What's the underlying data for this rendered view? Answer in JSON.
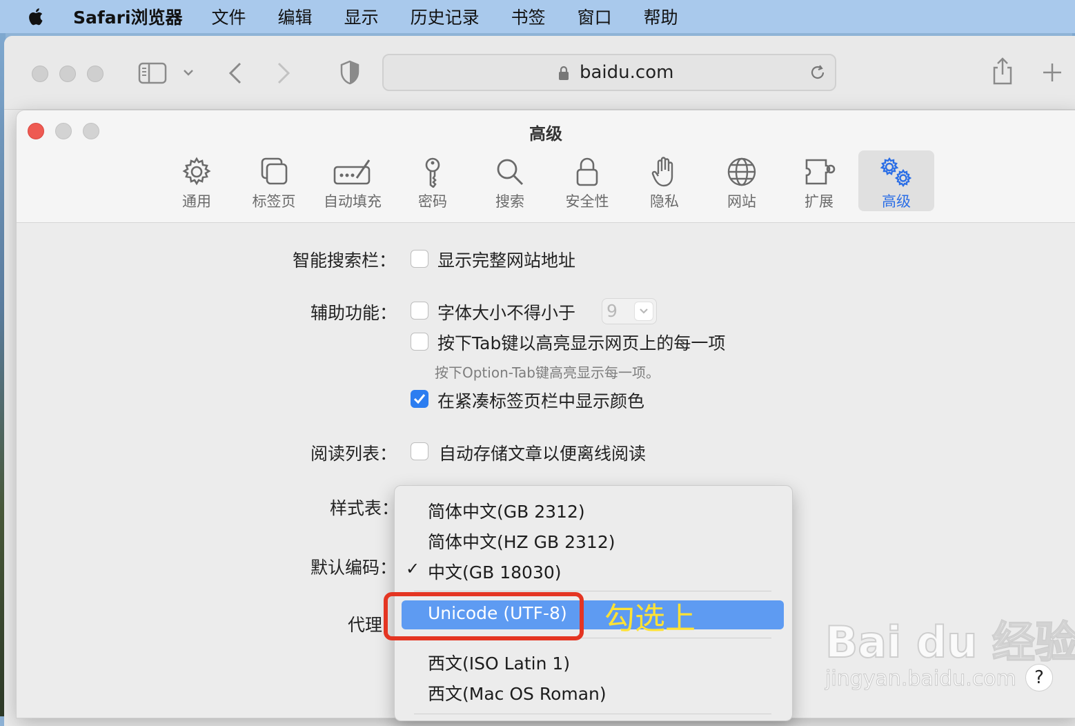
{
  "menubar": {
    "app_name": "Safari浏览器",
    "items": [
      "文件",
      "编辑",
      "显示",
      "历史记录",
      "书签",
      "窗口",
      "帮助"
    ]
  },
  "browser": {
    "address": "baidu.com"
  },
  "prefs": {
    "title": "高级",
    "tabs": [
      {
        "label": "通用",
        "icon": "gear-icon"
      },
      {
        "label": "标签页",
        "icon": "tabs-icon"
      },
      {
        "label": "自动填充",
        "icon": "autofill-icon"
      },
      {
        "label": "密码",
        "icon": "key-icon"
      },
      {
        "label": "搜索",
        "icon": "search-icon"
      },
      {
        "label": "安全性",
        "icon": "lock-icon"
      },
      {
        "label": "隐私",
        "icon": "hand-icon"
      },
      {
        "label": "网站",
        "icon": "globe-icon"
      },
      {
        "label": "扩展",
        "icon": "puzzle-icon"
      },
      {
        "label": "高级",
        "icon": "gears-icon",
        "active": true
      }
    ],
    "smart_search": {
      "label": "智能搜索栏：",
      "option": "显示完整网站地址",
      "checked": false
    },
    "accessibility": {
      "label": "辅助功能：",
      "option_font": "字体大小不得小于",
      "font_size": "9",
      "option_tab": "按下Tab键以高亮显示网页上的每一项",
      "hint": "按下Option-Tab键高亮显示每一项。",
      "option_color": "在紧凑标签页栏中显示颜色",
      "color_checked": true
    },
    "reading_list": {
      "label": "阅读列表：",
      "option": "自动存储文章以便离线阅读",
      "checked": false
    },
    "stylesheet_label": "样式表：",
    "encoding_label": "默认编码：",
    "proxy_label": "代理"
  },
  "encoding_menu": {
    "items": [
      "简体中文(GB 2312)",
      "简体中文(HZ GB 2312)",
      "中文(GB 18030)",
      "Unicode (UTF-8)",
      "西文(ISO Latin 1)",
      "西文(Mac OS Roman)"
    ],
    "checked_index": 2,
    "highlighted_index": 3
  },
  "annotation": {
    "text": "勾选上",
    "box_color": "#e43522",
    "text_color": "#ffe234"
  },
  "watermark": {
    "main": "Bai du 经验",
    "sub": "jingyan.baidu.com"
  },
  "help": "?",
  "colors": {
    "accent": "#2c7df0",
    "menubar": "#a9c9ec",
    "highlight": "#5e9bf2"
  }
}
